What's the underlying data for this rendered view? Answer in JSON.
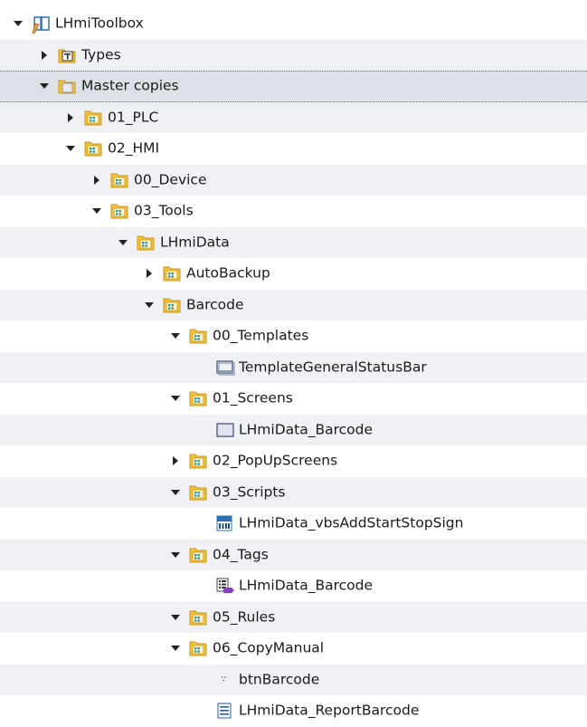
{
  "tree": {
    "nodes": [
      {
        "level": 0,
        "state": "expanded",
        "icon": "library-book-icon",
        "label": "LHmiToolbox"
      },
      {
        "level": 1,
        "state": "collapsed",
        "icon": "types-folder-icon",
        "label": "Types"
      },
      {
        "level": 1,
        "state": "expanded",
        "icon": "master-copies-folder-icon",
        "label": "Master copies",
        "selected": true
      },
      {
        "level": 2,
        "state": "collapsed",
        "icon": "master-copy-folder-icon",
        "label": "01_PLC"
      },
      {
        "level": 2,
        "state": "expanded",
        "icon": "master-copy-folder-icon",
        "label": "02_HMI"
      },
      {
        "level": 3,
        "state": "collapsed",
        "icon": "master-copy-folder-icon",
        "label": "00_Device"
      },
      {
        "level": 3,
        "state": "expanded",
        "icon": "master-copy-folder-icon",
        "label": "03_Tools"
      },
      {
        "level": 4,
        "state": "expanded",
        "icon": "master-copy-folder-icon",
        "label": "LHmiData"
      },
      {
        "level": 5,
        "state": "collapsed",
        "icon": "master-copy-folder-icon",
        "label": "AutoBackup"
      },
      {
        "level": 5,
        "state": "expanded",
        "icon": "master-copy-folder-icon",
        "label": "Barcode"
      },
      {
        "level": 6,
        "state": "expanded",
        "icon": "master-copy-folder-icon",
        "label": "00_Templates"
      },
      {
        "level": 7,
        "state": "leaf",
        "icon": "template-icon",
        "label": "TemplateGeneralStatusBar"
      },
      {
        "level": 6,
        "state": "expanded",
        "icon": "master-copy-folder-icon",
        "label": "01_Screens"
      },
      {
        "level": 7,
        "state": "leaf",
        "icon": "screen-icon",
        "label": "LHmiData_Barcode"
      },
      {
        "level": 6,
        "state": "collapsed",
        "icon": "master-copy-folder-icon",
        "label": "02_PopUpScreens"
      },
      {
        "level": 6,
        "state": "expanded",
        "icon": "master-copy-folder-icon",
        "label": "03_Scripts"
      },
      {
        "level": 7,
        "state": "leaf",
        "icon": "vbs-script-icon",
        "label": "LHmiData_vbsAddStartStopSign"
      },
      {
        "level": 6,
        "state": "expanded",
        "icon": "master-copy-folder-icon",
        "label": "04_Tags"
      },
      {
        "level": 7,
        "state": "leaf",
        "icon": "tag-table-icon",
        "label": "LHmiData_Barcode"
      },
      {
        "level": 6,
        "state": "expanded",
        "icon": "master-copy-folder-icon",
        "label": "05_Rules"
      },
      {
        "level": 6,
        "state": "expanded",
        "icon": "master-copy-folder-icon",
        "label": "06_CopyManual"
      },
      {
        "level": 7,
        "state": "leaf",
        "icon": "button-object-icon",
        "label": "btnBarcode"
      },
      {
        "level": 7,
        "state": "leaf",
        "icon": "report-icon",
        "label": "LHmiData_ReportBarcode"
      }
    ]
  },
  "colors": {
    "folder_yellow": "#f5c33b",
    "folder_dark": "#c8961e",
    "badge_teal": "#1f8fa6",
    "selection": "#dde1e7",
    "stripe": "#f0f1f4"
  }
}
